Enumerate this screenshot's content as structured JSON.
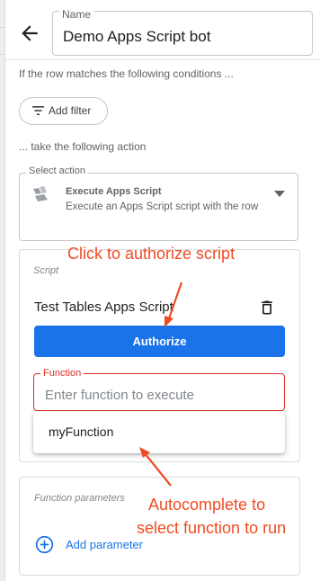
{
  "header": {
    "back_icon": "arrow-back-icon",
    "name_label": "Name",
    "name_value": "Demo Apps Script bot"
  },
  "conditions": {
    "hint": "If the row matches the following conditions ...",
    "add_filter_label": "Add filter",
    "add_filter_icon": "filter-list-icon"
  },
  "action": {
    "hint": "... take the following action",
    "select_label": "Select action",
    "selected_title": "Execute Apps Script",
    "selected_desc": "Execute an Apps Script script with the row",
    "icon": "apps-script-icon"
  },
  "script_card": {
    "label": "Script",
    "script_name": "Test Tables Apps Script",
    "delete_icon": "trash-icon",
    "authorize_label": "Authorize",
    "function_label": "Function",
    "function_placeholder": "Enter function to execute",
    "autocomplete_options": [
      "myFunction"
    ]
  },
  "params_card": {
    "label": "Function parameters",
    "add_label": "Add parameter",
    "add_icon": "add-circle-icon"
  },
  "annotations": {
    "authorize_note": "Click to authorize script",
    "autocomplete_note_line1": "Autocomplete to",
    "autocomplete_note_line2": "select function to run",
    "color": "#f04b23"
  },
  "colors": {
    "primary": "#1a73e8",
    "error": "#d93025",
    "border": "#c4c7c5"
  }
}
